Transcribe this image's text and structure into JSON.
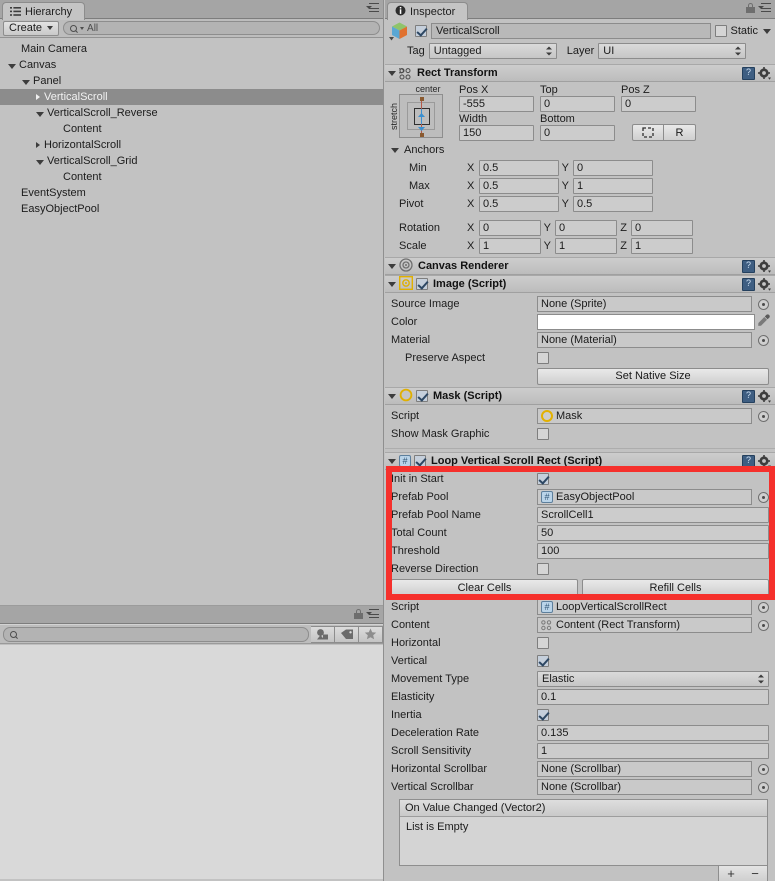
{
  "hierarchy": {
    "tab_label": "Hierarchy",
    "tab_icon": "hierarchy-list-icon",
    "create_label": "Create",
    "search_placeholder": "All",
    "search_value": "",
    "items": [
      {
        "label": "Main Camera",
        "depth": 0,
        "arrow": "none",
        "selected": false
      },
      {
        "label": "Canvas",
        "depth": 0,
        "arrow": "open",
        "selected": false
      },
      {
        "label": "Panel",
        "depth": 1,
        "arrow": "open",
        "selected": false
      },
      {
        "label": "VerticalScroll",
        "depth": 2,
        "arrow": "closed",
        "selected": true
      },
      {
        "label": "VerticalScroll_Reverse",
        "depth": 2,
        "arrow": "open",
        "selected": false
      },
      {
        "label": "Content",
        "depth": 3,
        "arrow": "none",
        "selected": false
      },
      {
        "label": "HorizontalScroll",
        "depth": 2,
        "arrow": "closed",
        "selected": false
      },
      {
        "label": "VerticalScroll_Grid",
        "depth": 2,
        "arrow": "open",
        "selected": false
      },
      {
        "label": "Content",
        "depth": 3,
        "arrow": "none",
        "selected": false
      },
      {
        "label": "EventSystem",
        "depth": 0,
        "arrow": "none",
        "selected": false
      },
      {
        "label": "EasyObjectPool",
        "depth": 0,
        "arrow": "none",
        "selected": false
      }
    ]
  },
  "project": {
    "search_placeholder": "",
    "search_value": "",
    "filter_buttons": [
      "type-filter-icon",
      "label-filter-icon",
      "favorite-star-icon"
    ]
  },
  "inspector": {
    "tab_label": "Inspector",
    "tab_icon": "info-circle-icon",
    "object": {
      "enabled": true,
      "name": "VerticalScroll",
      "static_label": "Static",
      "static_checked": false,
      "tag_label": "Tag",
      "tag_value": "Untagged",
      "layer_label": "Layer",
      "layer_value": "UI"
    },
    "rect_transform": {
      "title": "Rect Transform",
      "anchor_preset_top": "center",
      "anchor_preset_side": "stretch",
      "pos_x_label": "Pos X",
      "pos_x_value": "-555",
      "top_label": "Top",
      "top_value": "0",
      "pos_z_label": "Pos Z",
      "pos_z_value": "0",
      "width_label": "Width",
      "width_value": "150",
      "bottom_label": "Bottom",
      "bottom_value": "0",
      "blueprint_button": "blueprint-mode-icon",
      "raw_button": "R",
      "anchors_label": "Anchors",
      "min_label": "Min",
      "min_x": "0.5",
      "min_y": "0",
      "max_label": "Max",
      "max_x": "0.5",
      "max_y": "1",
      "pivot_label": "Pivot",
      "pivot_x": "0.5",
      "pivot_y": "0.5",
      "rotation_label": "Rotation",
      "rotation_x": "0",
      "rotation_y": "0",
      "rotation_z": "0",
      "scale_label": "Scale",
      "scale_x": "1",
      "scale_y": "1",
      "scale_z": "1",
      "axis_x": "X",
      "axis_y": "Y",
      "axis_z": "Z"
    },
    "canvas_renderer": {
      "title": "Canvas Renderer"
    },
    "image": {
      "title": "Image (Script)",
      "enabled": true,
      "source_image_label": "Source Image",
      "source_image_value": "None (Sprite)",
      "color_label": "Color",
      "color_value": "#FFFFFF",
      "material_label": "Material",
      "material_value": "None (Material)",
      "preserve_aspect_label": "Preserve Aspect",
      "preserve_aspect_checked": false,
      "set_native_size_label": "Set Native Size"
    },
    "mask": {
      "title": "Mask (Script)",
      "enabled": true,
      "script_label": "Script",
      "script_value": "Mask",
      "show_mask_graphic_label": "Show Mask Graphic",
      "show_mask_graphic_checked": false
    },
    "loop_scroll": {
      "title": "Loop Vertical Scroll Rect (Script)",
      "enabled": true,
      "highlight_color": "#F5302C",
      "init_in_start_label": "Init in Start",
      "init_in_start_checked": true,
      "prefab_pool_label": "Prefab Pool",
      "prefab_pool_value": "EasyObjectPool",
      "prefab_pool_name_label": "Prefab Pool Name",
      "prefab_pool_name_value": "ScrollCell1",
      "total_count_label": "Total Count",
      "total_count_value": "50",
      "threshold_label": "Threshold",
      "threshold_value": "100",
      "reverse_direction_label": "Reverse Direction",
      "reverse_direction_checked": false,
      "clear_cells_label": "Clear Cells",
      "refill_cells_label": "Refill Cells",
      "script_label": "Script",
      "script_value": "LoopVerticalScrollRect",
      "content_label": "Content",
      "content_value": "Content (Rect Transform)",
      "horizontal_label": "Horizontal",
      "horizontal_checked": false,
      "vertical_label": "Vertical",
      "vertical_checked": true,
      "movement_type_label": "Movement Type",
      "movement_type_value": "Elastic",
      "elasticity_label": "Elasticity",
      "elasticity_value": "0.1",
      "inertia_label": "Inertia",
      "inertia_checked": true,
      "deceleration_rate_label": "Deceleration Rate",
      "deceleration_rate_value": "0.135",
      "scroll_sensitivity_label": "Scroll Sensitivity",
      "scroll_sensitivity_value": "1",
      "horizontal_scrollbar_label": "Horizontal Scrollbar",
      "horizontal_scrollbar_value": "None (Scrollbar)",
      "vertical_scrollbar_label": "Vertical Scrollbar",
      "vertical_scrollbar_value": "None (Scrollbar)",
      "event_header": "On Value Changed (Vector2)",
      "event_empty_text": "List is Empty",
      "add_button": "+",
      "remove_button": "−"
    }
  }
}
